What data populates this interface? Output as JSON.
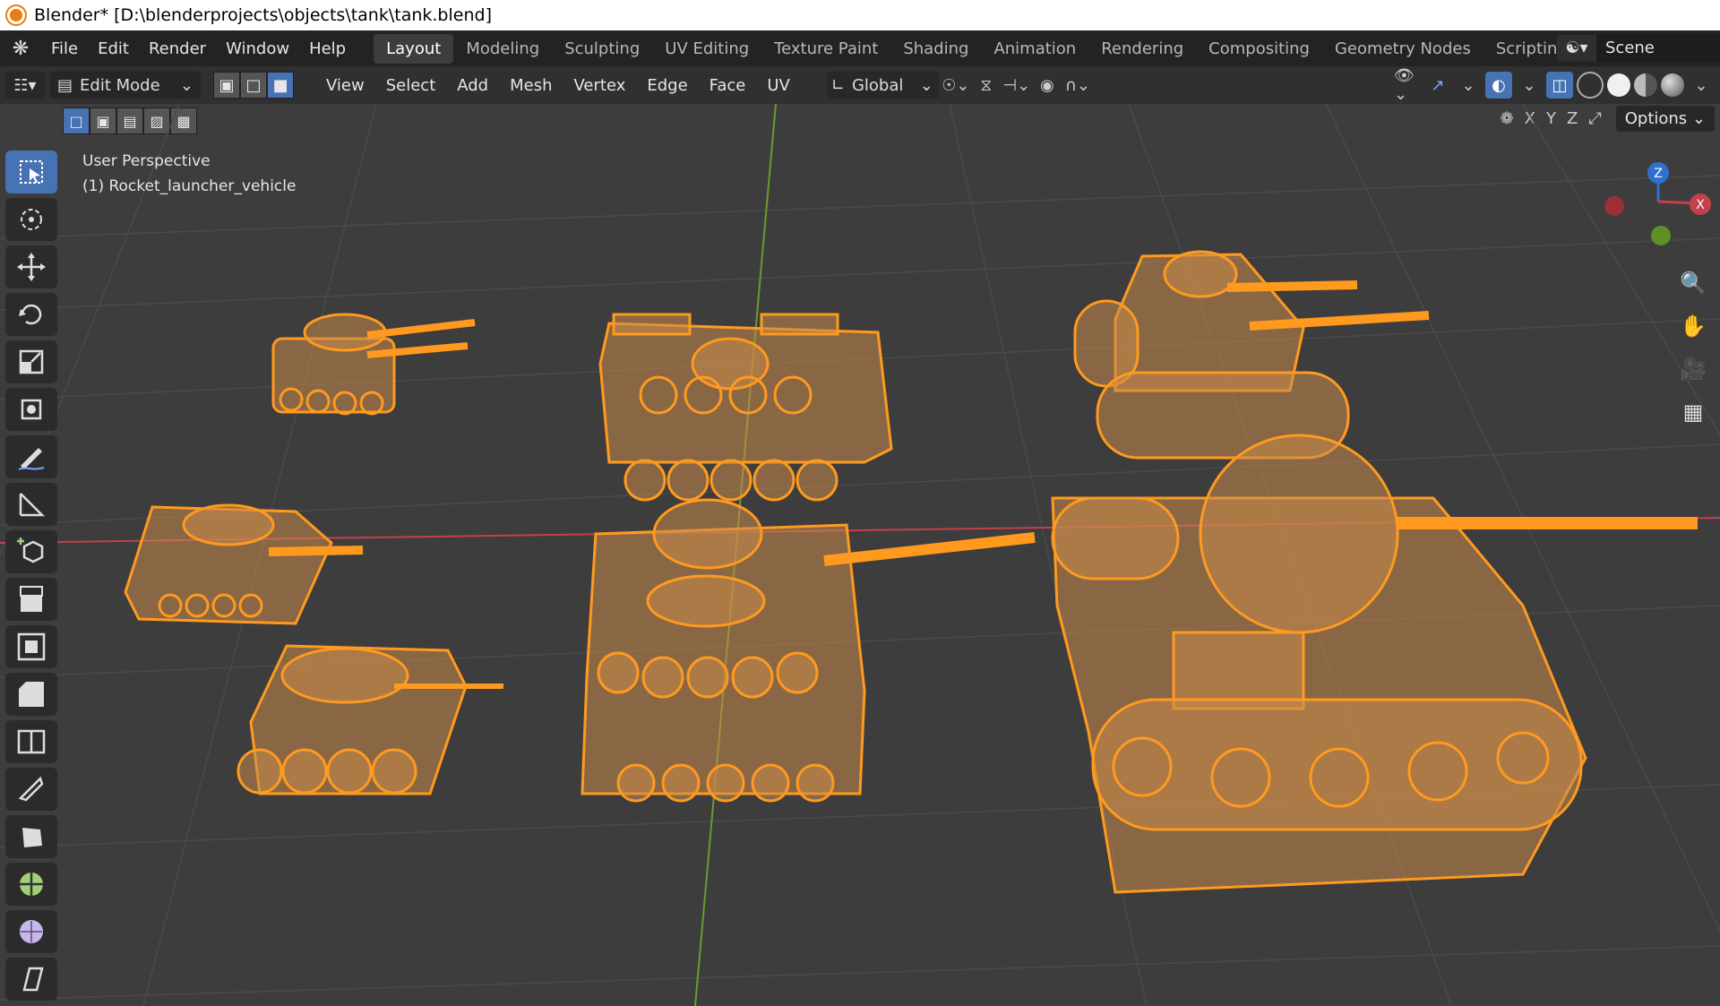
{
  "window": {
    "title": "Blender* [D:\\blenderprojects\\objects\\tank\\tank.blend]"
  },
  "topbar": {
    "menus": [
      "File",
      "Edit",
      "Render",
      "Window",
      "Help"
    ],
    "tabs": [
      "Layout",
      "Modeling",
      "Sculpting",
      "UV Editing",
      "Texture Paint",
      "Shading",
      "Animation",
      "Rendering",
      "Compositing",
      "Geometry Nodes",
      "Scripting"
    ],
    "active_tab": "Layout",
    "add_tab": "+",
    "scene": "Scene"
  },
  "header": {
    "mode": "Edit Mode",
    "menus": [
      "View",
      "Select",
      "Add",
      "Mesh",
      "Vertex",
      "Edge",
      "Face",
      "UV"
    ],
    "transform_orientation": "Global",
    "select_mode_active": "face"
  },
  "axis_lock": {
    "x": "X",
    "y": "Y",
    "z": "Z",
    "options": "Options"
  },
  "viewport": {
    "perspective": "User Perspective",
    "object": "(1) Rocket_launcher_vehicle"
  },
  "gizmo": {
    "z": "Z",
    "x": "X"
  },
  "colors": {
    "mesh": "#ff9a1f",
    "mesh_fill": "#c98a4a",
    "grid": "#4a4a4a",
    "x_axis": "#c2414a",
    "y_axis": "#6c9a2f",
    "accent": "#4772b3"
  },
  "icons": {
    "tools": [
      "select-box-icon",
      "cursor-icon",
      "move-icon",
      "rotate-icon",
      "scale-icon",
      "transform-icon",
      "annotate-icon",
      "measure-icon",
      "add-cube-icon",
      "extrude-icon",
      "inset-icon",
      "bevel-icon",
      "loop-cut-icon",
      "knife-icon",
      "poly-build-icon",
      "spin-icon",
      "smooth-icon",
      "shear-icon"
    ],
    "nav": [
      "zoom-icon",
      "pan-hand-icon",
      "camera-icon",
      "grid-icon"
    ]
  }
}
